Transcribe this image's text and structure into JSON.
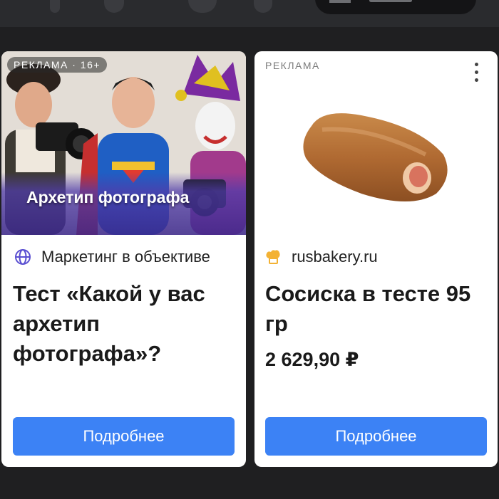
{
  "left_card": {
    "ad_label": "РЕКЛАМА · 16+",
    "banner_caption": "Архетип фотографа",
    "source": "Маркетинг в объективе",
    "title": "Тест «Какой у вас архетип фотографа»?",
    "cta": "Подробнее",
    "icon": "globe-icon"
  },
  "right_card": {
    "ad_label": "РЕКЛАМА",
    "source": "rusbakery.ru",
    "title": "Сосиска в тесте 95 гр",
    "price": "2 629,90 ₽",
    "cta": "Подробнее",
    "icon": "chef-hat-icon"
  },
  "colors": {
    "background": "#1f1f21",
    "card": "#ffffff",
    "button": "#3c82f5",
    "globe": "#5a4fd1",
    "chef_hat": "#f3b234"
  }
}
